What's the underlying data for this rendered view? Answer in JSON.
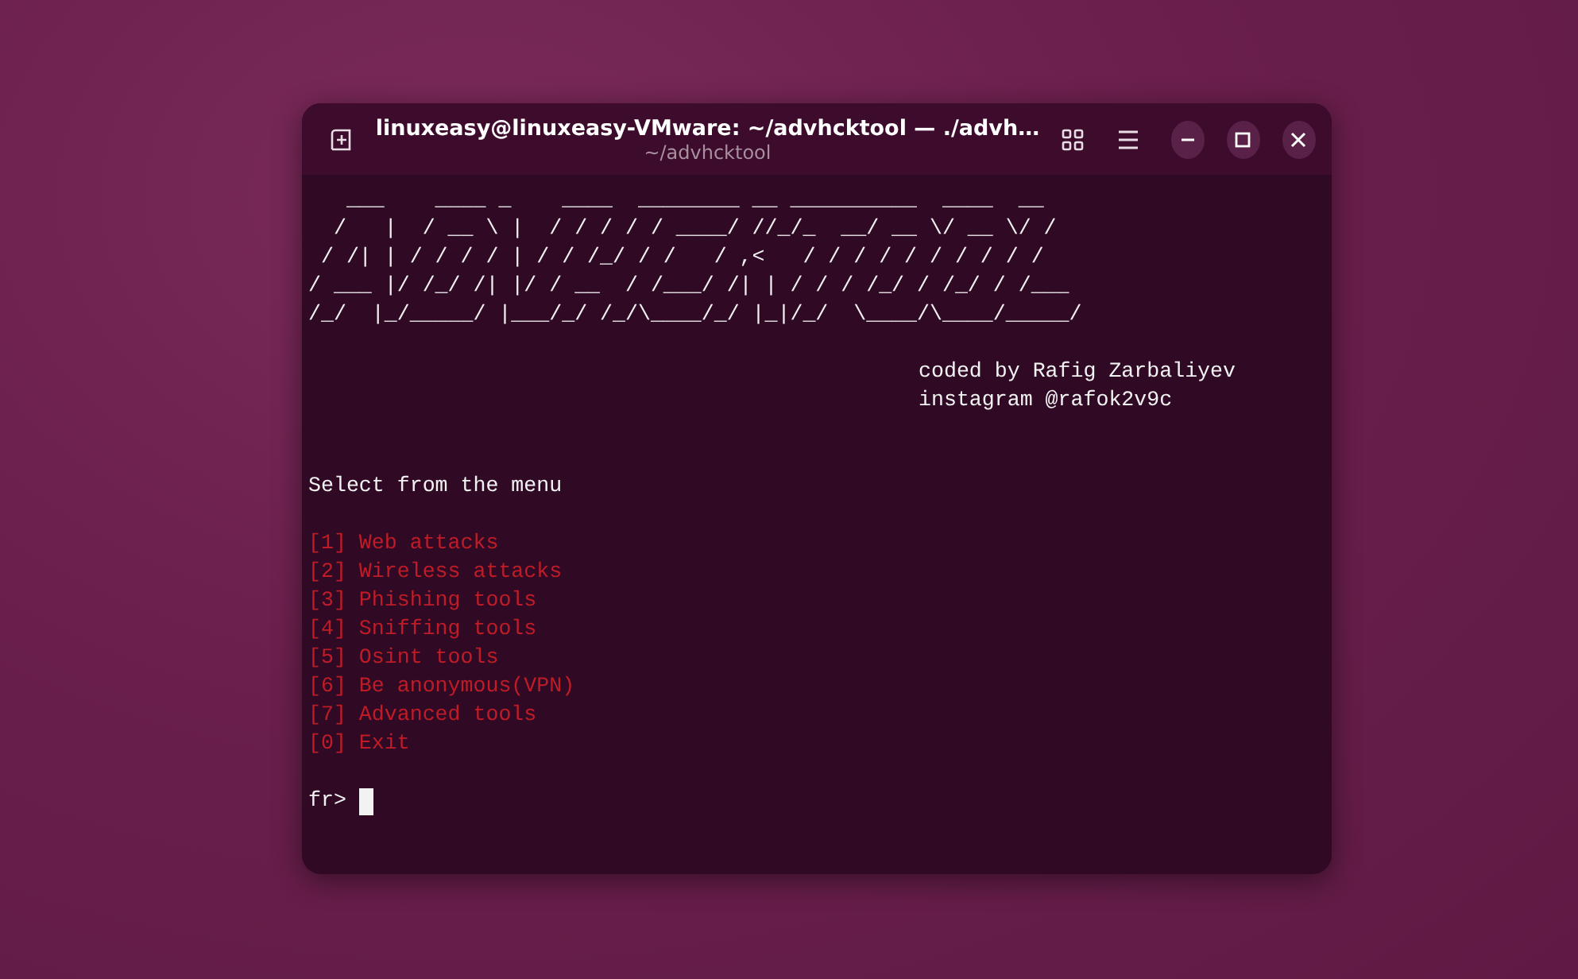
{
  "window": {
    "title": "linuxeasy@linuxeasy-VMware: ~/advhcktool — ./advh…",
    "subtitle": "~/advhcktool"
  },
  "terminal": {
    "banner": [
      "   ___    ____ _    ____  ________ __ __________  ____  __",
      "  /   |  / __ \\ |  / / / / / ____/ //_/_  __/ __ \\/ __ \\/ /",
      " / /| | / / / / | / / /_/ / /   / ,<   / / / / / / / / / /",
      "/ ___ |/ /_/ /| |/ / __  / /___/ /| | / / / /_/ / /_/ / /___",
      "/_/  |_/_____/ |___/_/ /_/\\____/_/ |_|/_/  \\____/\\____/_____/"
    ],
    "credits": [
      "coded by Rafig Zarbaliyev",
      "instagram @rafok2v9c"
    ],
    "prompt_title": "Select from the menu",
    "menu": [
      {
        "text": "[1] Web attacks"
      },
      {
        "text": "[2] Wireless attacks"
      },
      {
        "text": "[3] Phishing tools"
      },
      {
        "text": "[4] Sniffing tools"
      },
      {
        "text": "[5] Osint tools"
      },
      {
        "text": "[6] Be anonymous(VPN)"
      },
      {
        "text": "[7] Advanced tools"
      },
      {
        "text": "[0] Exit"
      }
    ],
    "input_prompt": "fr>"
  }
}
